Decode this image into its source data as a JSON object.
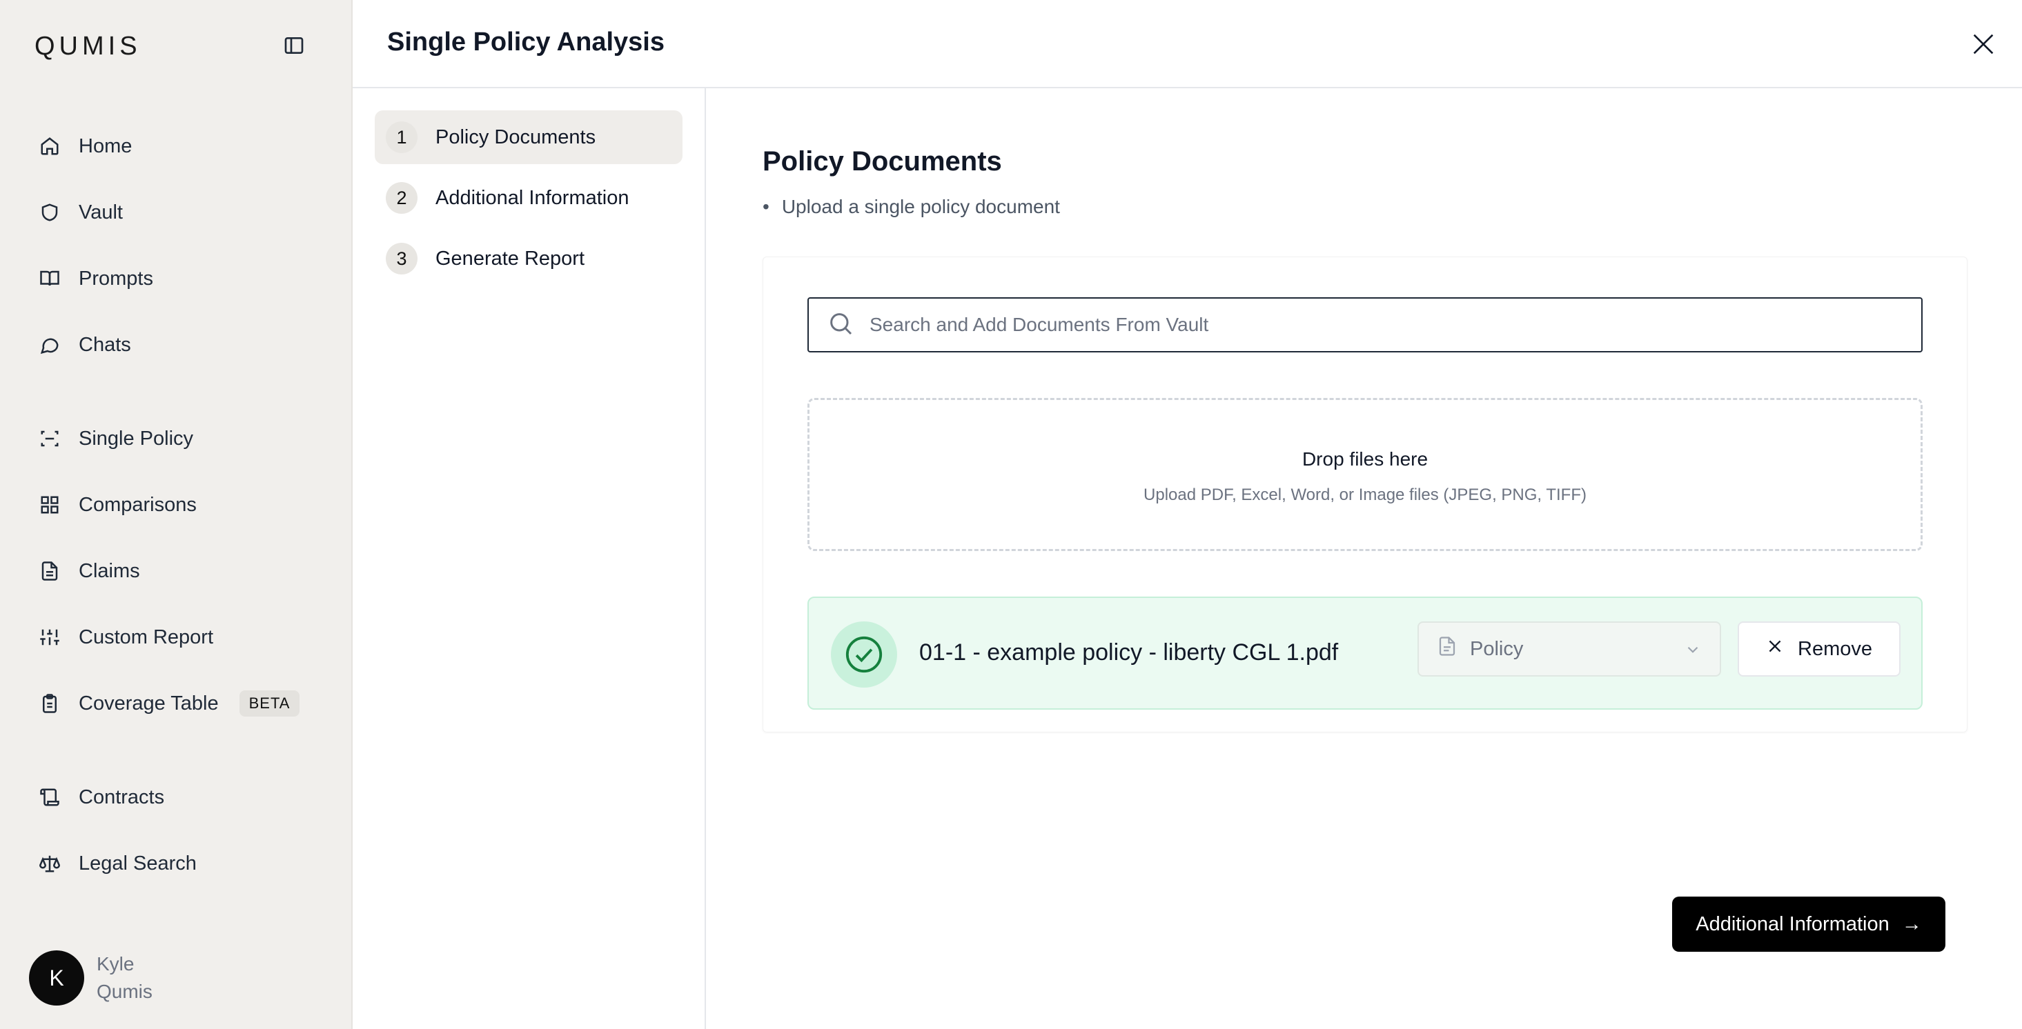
{
  "brand": {
    "logo": "QUMIS"
  },
  "sidebar": {
    "items": [
      {
        "label": "Home",
        "icon": "home-icon"
      },
      {
        "label": "Vault",
        "icon": "shield-icon"
      },
      {
        "label": "Prompts",
        "icon": "book-icon"
      },
      {
        "label": "Chats",
        "icon": "chat-icon"
      },
      {
        "label": "Single Policy",
        "icon": "scan-icon"
      },
      {
        "label": "Comparisons",
        "icon": "grid-icon"
      },
      {
        "label": "Claims",
        "icon": "file-text-icon"
      },
      {
        "label": "Custom Report",
        "icon": "sliders-icon"
      },
      {
        "label": "Coverage Table",
        "icon": "clipboard-icon",
        "badge": "BETA"
      },
      {
        "label": "Contracts",
        "icon": "scroll-icon"
      },
      {
        "label": "Legal Search",
        "icon": "scale-icon"
      }
    ],
    "user": {
      "initial": "K",
      "first_name": "Kyle",
      "last_name": "Qumis"
    }
  },
  "header": {
    "title": "Single Policy Analysis"
  },
  "steps": [
    {
      "num": "1",
      "label": "Policy Documents"
    },
    {
      "num": "2",
      "label": "Additional Information"
    },
    {
      "num": "3",
      "label": "Generate Report"
    }
  ],
  "main": {
    "title": "Policy Documents",
    "bullet": "Upload a single policy document",
    "search": {
      "placeholder": "Search and Add Documents From Vault"
    },
    "dropzone": {
      "title": "Drop files here",
      "subtitle": "Upload PDF, Excel, Word, or Image files (JPEG, PNG, TIFF)"
    },
    "file": {
      "name": "01-1 - example policy - liberty CGL 1.pdf",
      "type": "Policy",
      "remove_label": "Remove"
    },
    "next_button": {
      "label": "Additional Information",
      "arrow": "→"
    }
  },
  "colors": {
    "accent": "#000000",
    "success_bg": "#ebfaf2",
    "success_icon": "#15803d",
    "sidebar_bg": "#f1efec"
  }
}
